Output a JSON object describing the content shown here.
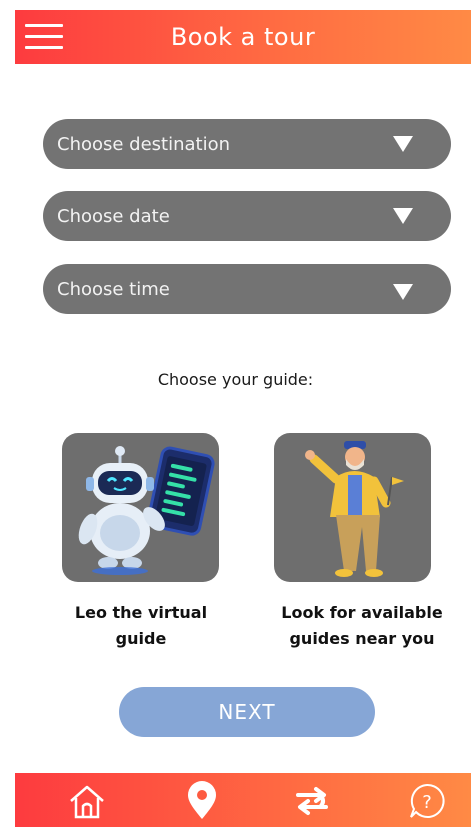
{
  "header": {
    "title": "Book a tour",
    "menu_icon": "hamburger-menu-icon",
    "gradient_start": "#fd3b3f",
    "gradient_end": "#ff8a45"
  },
  "form": {
    "destination_placeholder": "Choose destination",
    "date_placeholder": "Choose date",
    "time_placeholder": "Choose time",
    "dropdown_color": "#737373"
  },
  "guide_section": {
    "label": "Choose your guide:",
    "options": [
      {
        "caption": "Leo  the virtual\nguide",
        "icon": "robot-icon"
      },
      {
        "caption": "Look for available\nguides near you",
        "icon": "tour-guide-icon"
      }
    ]
  },
  "next_button": {
    "label": "NEXT",
    "color": "#86a6d6"
  },
  "bottom_nav": {
    "items": [
      {
        "icon": "home-icon"
      },
      {
        "icon": "map-pin-icon"
      },
      {
        "icon": "swap-icon"
      },
      {
        "icon": "help-icon"
      }
    ]
  }
}
